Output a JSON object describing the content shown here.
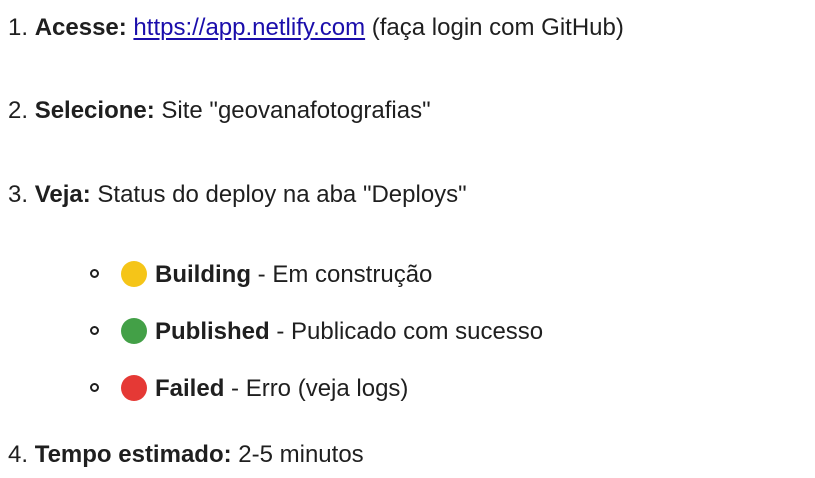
{
  "steps": [
    {
      "number": "1.",
      "label": "Acesse:",
      "link": "https://app.netlify.com",
      "text": "(faça login com GitHub)"
    },
    {
      "number": "2.",
      "label": "Selecione:",
      "text": "Site \"geovanafotografias\""
    },
    {
      "number": "3.",
      "label": "Veja:",
      "text": "Status do deploy na aba \"Deploys\""
    },
    {
      "number": "4.",
      "label": "Tempo estimado:",
      "text": "2-5 minutos"
    }
  ],
  "statuses": [
    {
      "name": "Building",
      "description": "- Em construção",
      "color": "#f5c518",
      "icon": "yellow-circle"
    },
    {
      "name": "Published",
      "description": "- Publicado com sucesso",
      "color": "#43a047",
      "icon": "green-circle"
    },
    {
      "name": "Failed",
      "description": "- Erro (veja logs)",
      "color": "#e53935",
      "icon": "red-circle"
    }
  ]
}
